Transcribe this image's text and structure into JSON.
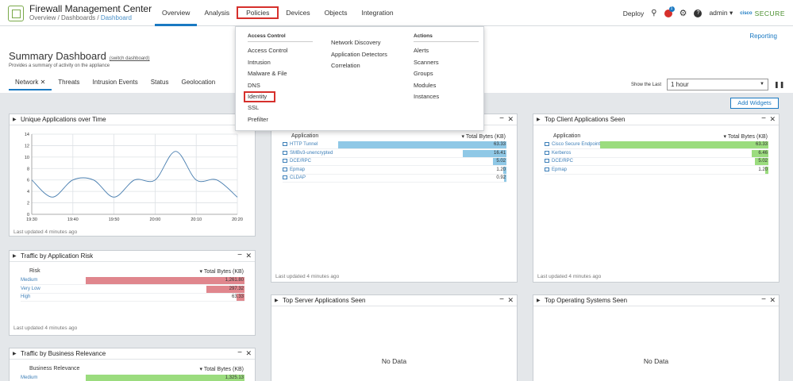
{
  "app": {
    "title": "Firewall Management Center",
    "breadcrumb": [
      "Overview",
      "Dashboards",
      "Dashboard"
    ]
  },
  "nav": [
    "Overview",
    "Analysis",
    "Policies",
    "Devices",
    "Objects",
    "Integration"
  ],
  "right_nav": {
    "deploy": "Deploy",
    "badge": "1",
    "user": "admin ▾",
    "cisco": "cisco",
    "secure": "SECURE"
  },
  "header": {
    "reporting": "Reporting",
    "title": "Summary Dashboard",
    "switch": "(switch dashboard)",
    "subtitle": "Provides a summary of activity on the appliance",
    "tabs": [
      "Network",
      "Threats",
      "Intrusion Events",
      "Status",
      "Geolocation"
    ],
    "show_last_label": "Show the Last",
    "show_last_value": "1 hour",
    "add_widgets": "Add Widgets"
  },
  "dropdown": {
    "col1_head": "Access Control",
    "col1": [
      "Access Control",
      "Intrusion",
      "Malware & File",
      "DNS",
      "Identity",
      "SSL",
      "Prefilter"
    ],
    "col2": [
      "Network Discovery",
      "Application Detectors",
      "Correlation"
    ],
    "col3_head": "Actions",
    "col3": [
      "Alerts",
      "Scanners",
      "Groups",
      "Modules",
      "Instances"
    ]
  },
  "widgets": {
    "unique_apps": {
      "title": "Unique Applications over Time",
      "updated": "Last updated 4 minutes ago"
    },
    "traffic_risk": {
      "title": "Traffic by Application Risk",
      "col1": "Risk",
      "col2": "▾ Total Bytes (KB)",
      "rows": [
        {
          "label": "Medium",
          "value": "1,261.80",
          "frac": 1.0
        },
        {
          "label": "Very Low",
          "value": "297.32",
          "frac": 0.24
        },
        {
          "label": "High",
          "value": "63.33",
          "frac": 0.05
        }
      ],
      "updated": "Last updated 4 minutes ago"
    },
    "traffic_biz": {
      "title": "Traffic by Business Relevance",
      "col1": "Business Relevance",
      "col2": "▾ Total Bytes (KB)",
      "rows": [
        {
          "label": "Medium",
          "value": "1,325.13",
          "frac": 1.0
        }
      ]
    },
    "top_web": {
      "col1": "Application",
      "col2": "▾ Total Bytes (KB)",
      "rows": [
        {
          "label": "HTTP Tunnel",
          "value": "63.33",
          "frac": 1.0
        },
        {
          "label": "SMBv3-unencrypted",
          "value": "16.41",
          "frac": 0.26
        },
        {
          "label": "DCE/RPC",
          "value": "5.02",
          "frac": 0.08
        },
        {
          "label": "Epmap",
          "value": "1.20",
          "frac": 0.02
        },
        {
          "label": "CLDAP",
          "value": "0.92",
          "frac": 0.015
        }
      ],
      "updated": "Last updated 4 minutes ago"
    },
    "top_client": {
      "title": "Top Client Applications Seen",
      "col1": "Application",
      "col2": "▾ Total Bytes (KB)",
      "rows": [
        {
          "label": "Cisco Secure Endpoint",
          "value": "63.33",
          "frac": 1.0
        },
        {
          "label": "Kerberos",
          "value": "6.46",
          "frac": 0.1
        },
        {
          "label": "DCE/RPC",
          "value": "5.02",
          "frac": 0.08
        },
        {
          "label": "Epmap",
          "value": "1.20",
          "frac": 0.02
        }
      ],
      "updated": "Last updated 4 minutes ago"
    },
    "top_server": {
      "title": "Top Server Applications Seen",
      "nodata": "No Data"
    },
    "top_os": {
      "title": "Top Operating Systems Seen",
      "nodata": "No Data"
    }
  },
  "chart_data": {
    "type": "line",
    "title": "",
    "x": [
      "19:30",
      "19:35",
      "19:40",
      "19:45",
      "19:50",
      "19:55",
      "20:00",
      "20:05",
      "20:10",
      "20:15",
      "20:20"
    ],
    "series": [
      {
        "values": [
          6,
          3,
          6,
          6,
          3,
          6,
          6,
          11,
          6,
          6,
          3
        ]
      }
    ],
    "x_ticks": [
      "19:30",
      "19:40",
      "19:50",
      "20:00",
      "20:10",
      "20:20"
    ],
    "y_ticks": [
      0,
      2,
      4,
      6,
      8,
      10,
      12,
      14
    ],
    "ylim": [
      0,
      14
    ],
    "grid": true,
    "color": "#4a7fb0"
  }
}
